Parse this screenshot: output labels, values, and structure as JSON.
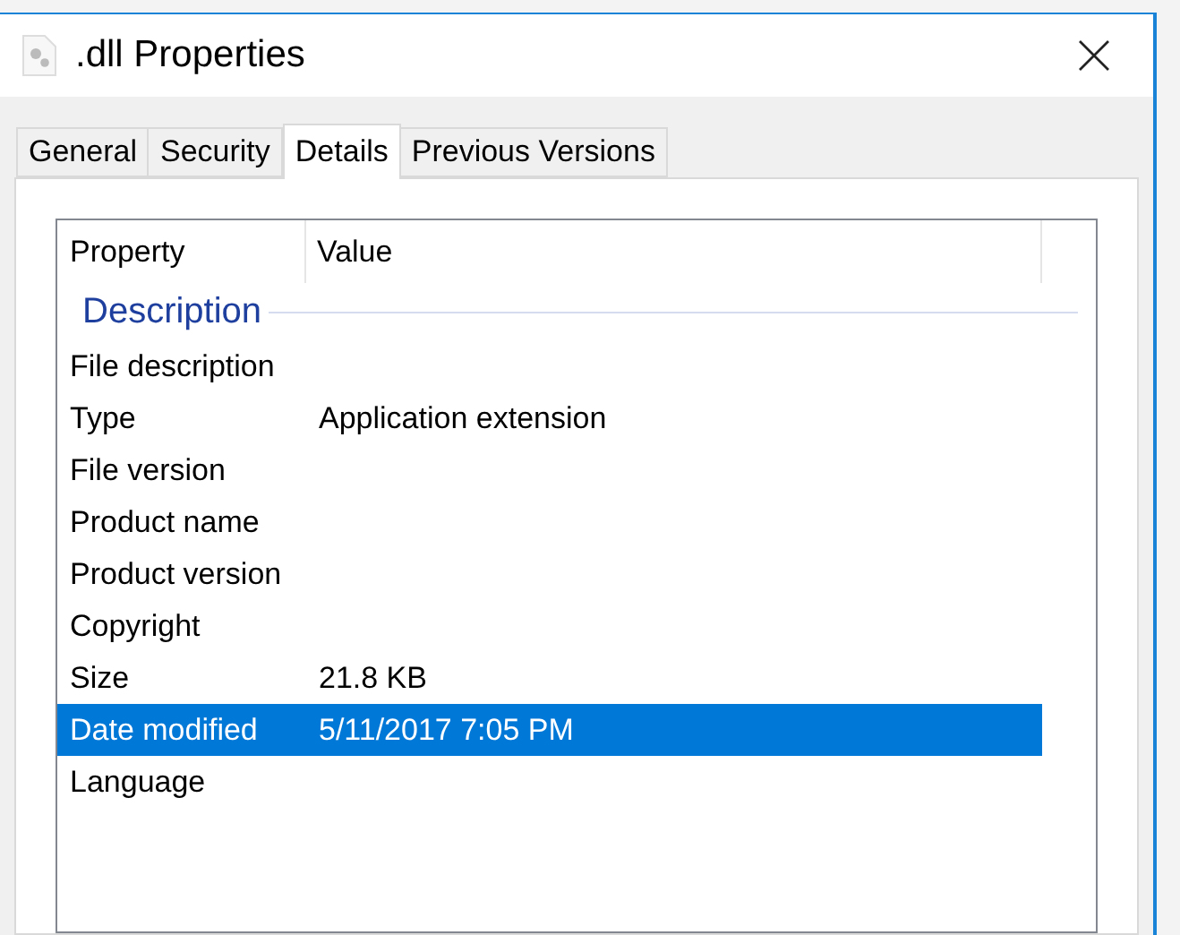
{
  "window": {
    "title": ".dll Properties"
  },
  "tabs": [
    {
      "label": "General",
      "selected": false
    },
    {
      "label": "Security",
      "selected": false
    },
    {
      "label": "Details",
      "selected": true
    },
    {
      "label": "Previous Versions",
      "selected": false
    }
  ],
  "table": {
    "columns": [
      "Property",
      "Value"
    ],
    "rows": [
      {
        "kind": "group",
        "label": "Description"
      },
      {
        "kind": "item",
        "property": "File description",
        "value": "",
        "selected": false
      },
      {
        "kind": "item",
        "property": "Type",
        "value": "Application extension",
        "selected": false
      },
      {
        "kind": "item",
        "property": "File version",
        "value": "",
        "selected": false
      },
      {
        "kind": "item",
        "property": "Product name",
        "value": "",
        "selected": false
      },
      {
        "kind": "item",
        "property": "Product version",
        "value": "",
        "selected": false
      },
      {
        "kind": "item",
        "property": "Copyright",
        "value": "",
        "selected": false
      },
      {
        "kind": "item",
        "property": "Size",
        "value": "21.8 KB",
        "selected": false
      },
      {
        "kind": "item",
        "property": "Date modified",
        "value": "5/11/2017 7:05 PM",
        "selected": true
      },
      {
        "kind": "item",
        "property": "Language",
        "value": "",
        "selected": false
      }
    ]
  }
}
